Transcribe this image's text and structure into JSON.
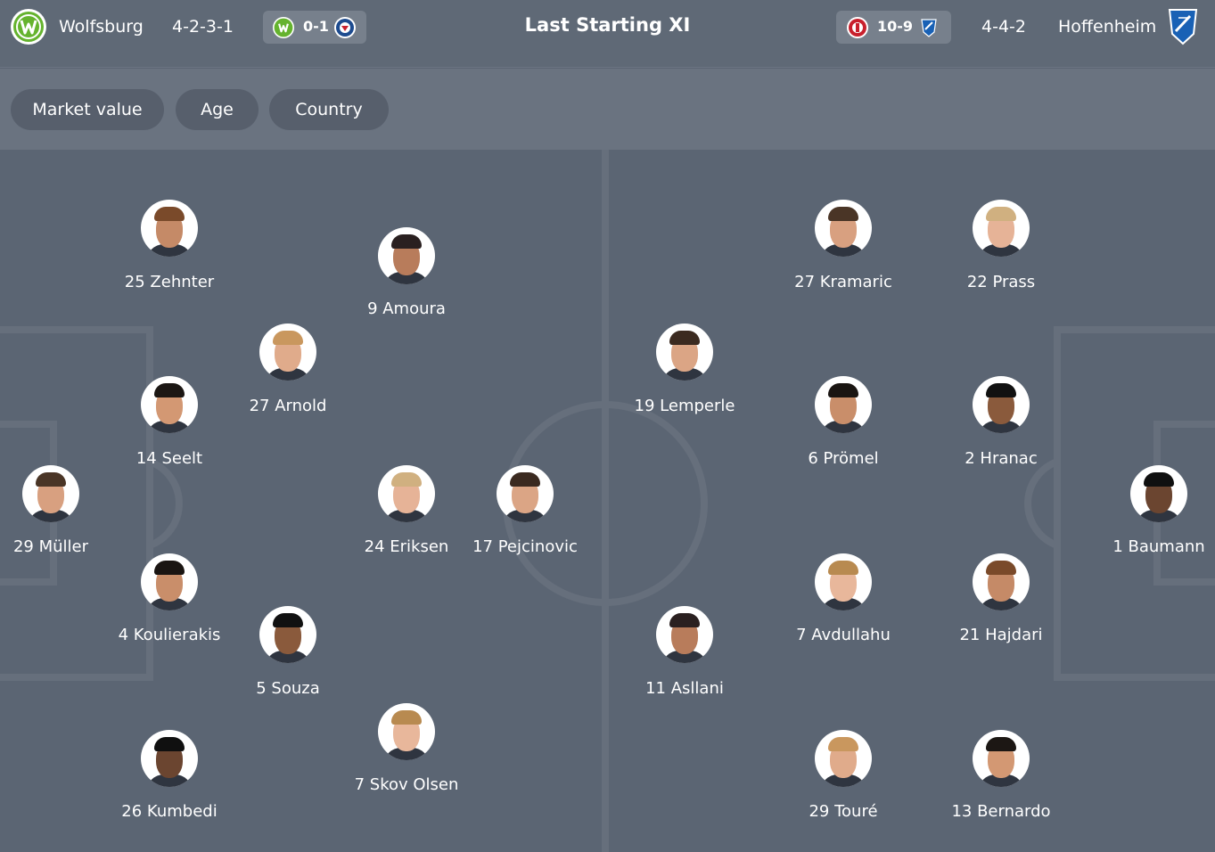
{
  "header": {
    "home_team": "Wolfsburg",
    "home_formation": "4-2-3-1",
    "home_last_score": "0-1",
    "title": "Last Starting XI",
    "away_last_score": "10-9",
    "away_formation": "4-4-2",
    "away_team": "Hoffenheim",
    "home_crest_icon": "wolfsburg-crest-icon",
    "away_crest_icon": "hoffenheim-crest-icon"
  },
  "filters": [
    "Market value",
    "Age",
    "Country"
  ],
  "colors": {
    "background": "#5b6573",
    "header": "#5f6976",
    "filter_bar": "#6a7380",
    "button": "#575f6c",
    "wolfsburg_green": "#65b32e",
    "hoffenheim_blue": "#1961b5",
    "st_pauli_red": "#c8202d"
  },
  "home_players": [
    {
      "label": "25 Zehnter"
    },
    {
      "label": "9 Amoura"
    },
    {
      "label": "27 Arnold"
    },
    {
      "label": "14 Seelt"
    },
    {
      "label": "29 Müller"
    },
    {
      "label": "24 Eriksen"
    },
    {
      "label": "17 Pejcinovic"
    },
    {
      "label": "4 Koulierakis"
    },
    {
      "label": "5 Souza"
    },
    {
      "label": "26 Kumbedi"
    },
    {
      "label": "7 Skov Olsen"
    }
  ],
  "away_players": [
    {
      "label": "27 Kramaric"
    },
    {
      "label": "22 Prass"
    },
    {
      "label": "19 Lemperle"
    },
    {
      "label": "6 Prömel"
    },
    {
      "label": "2 Hranac"
    },
    {
      "label": "1 Baumann"
    },
    {
      "label": "7 Avdullahu"
    },
    {
      "label": "21 Hajdari"
    },
    {
      "label": "11 Asllani"
    },
    {
      "label": "29 Touré"
    },
    {
      "label": "13 Bernardo"
    }
  ]
}
